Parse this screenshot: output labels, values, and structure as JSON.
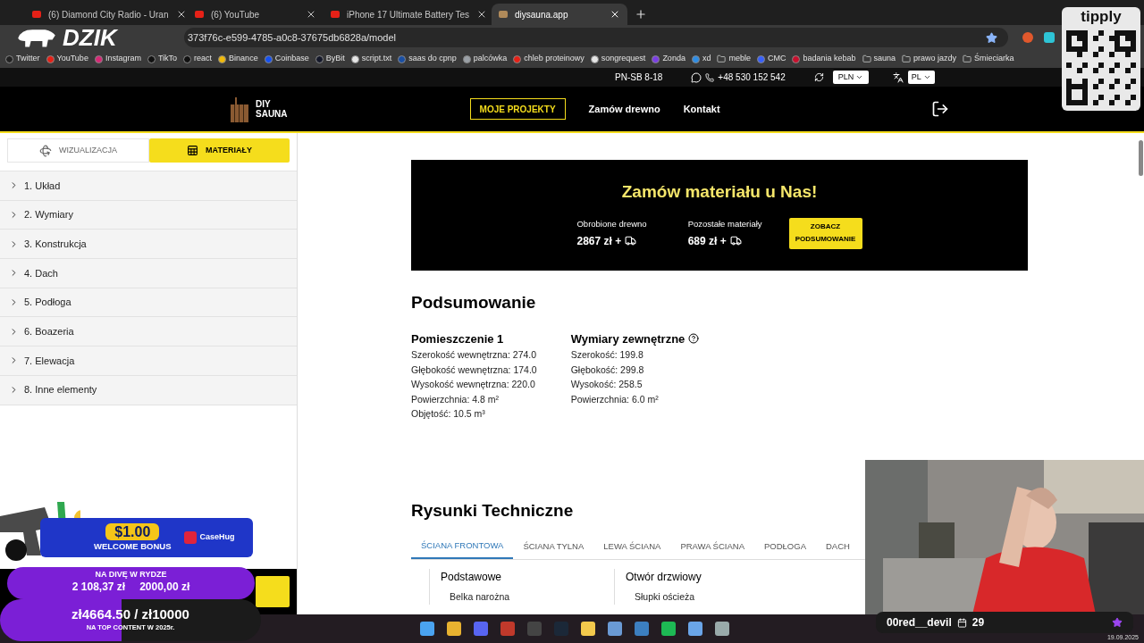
{
  "browser": {
    "tabs": [
      {
        "title": "(6) Diamond City Radio - Uran",
        "selected": false
      },
      {
        "title": "(6) YouTube",
        "selected": false
      },
      {
        "title": "iPhone 17 Ultimate Battery Tes",
        "selected": false
      },
      {
        "title": "diysauna.app",
        "selected": true
      }
    ],
    "url": "373f76c-e599-4785-a0c8-37675db6828a/model",
    "bookmarks": [
      {
        "label": "Twitter",
        "kind": "site",
        "color": "#222222"
      },
      {
        "label": "YouTube",
        "kind": "site",
        "color": "#e62117"
      },
      {
        "label": "Instagram",
        "kind": "site",
        "color": "#d62976"
      },
      {
        "label": "TikTo",
        "kind": "site",
        "color": "#111111"
      },
      {
        "label": "react",
        "kind": "site",
        "color": "#111111"
      },
      {
        "label": "Binance",
        "kind": "site",
        "color": "#f0b90b"
      },
      {
        "label": "Coinbase",
        "kind": "site",
        "color": "#1652f0"
      },
      {
        "label": "ByBit",
        "kind": "site",
        "color": "#15192a"
      },
      {
        "label": "script.txt",
        "kind": "site",
        "color": "#e6e6e6"
      },
      {
        "label": "saas do cpnp",
        "kind": "site",
        "color": "#1a4fa3"
      },
      {
        "label": "palcówka",
        "kind": "site",
        "color": "#9aa0a6"
      },
      {
        "label": "chleb proteinowy",
        "kind": "site",
        "color": "#e62117"
      },
      {
        "label": "songrequest",
        "kind": "site",
        "color": "#e6e6e6"
      },
      {
        "label": "Zonda",
        "kind": "site",
        "color": "#7b3fe4"
      },
      {
        "label": "xd",
        "kind": "site",
        "color": "#2f8de4"
      },
      {
        "label": "meble",
        "kind": "folder"
      },
      {
        "label": "CMC",
        "kind": "site",
        "color": "#3861fb"
      },
      {
        "label": "badania kebab",
        "kind": "site",
        "color": "#c8102e"
      },
      {
        "label": "sauna",
        "kind": "folder"
      },
      {
        "label": "prawo jazdy",
        "kind": "folder"
      },
      {
        "label": "Śmieciarka",
        "kind": "folder"
      }
    ]
  },
  "site": {
    "info_bar": {
      "hours": "PN-SB 8-18",
      "phone": "+48 530 152 542",
      "currency": "PLN",
      "language": "PL"
    },
    "logo": {
      "line1": "DIY",
      "line2": "SAUNA"
    },
    "nav": [
      {
        "label": "MOJE PROJEKTY",
        "kind": "button"
      },
      {
        "label": "Zamów drewno",
        "kind": "link"
      },
      {
        "label": "Kontakt",
        "kind": "link"
      }
    ],
    "view_toggle": [
      {
        "label": "WIZUALIZACJA",
        "selected": false
      },
      {
        "label": "MATERIAŁY",
        "selected": true
      }
    ],
    "sections": [
      {
        "label": "1. Układ",
        "expanded": false
      },
      {
        "label": "2. Wymiary",
        "expanded": false
      },
      {
        "label": "3. Konstrukcja",
        "expanded": false
      },
      {
        "label": "4. Dach",
        "expanded": false
      },
      {
        "label": "5. Podłoga",
        "expanded": false
      },
      {
        "label": "6. Boazeria",
        "expanded": false
      },
      {
        "label": "7. Elewacja",
        "expanded": false
      },
      {
        "label": "8. Inne elementy",
        "expanded": false
      }
    ],
    "banner": {
      "title": "Zamów materiału u Nas!",
      "prices": [
        {
          "label": "Obrobione drewno",
          "value": "2867 zł +"
        },
        {
          "label": "Pozostałe materiały",
          "value": "689 zł +"
        }
      ],
      "button_lines": [
        "ZOBACZ",
        "PODSUMOWANIE"
      ]
    },
    "summary": {
      "title": "Podsumowanie",
      "columns": [
        {
          "heading": "Pomieszczenie 1",
          "help": false,
          "lines": [
            "Szerokość wewnętrzna: 274.0",
            "Głębokość wewnętrzna: 174.0",
            "Wysokość wewnętrzna: 220.0",
            "Powierzchnia: 4.8 m²",
            "Objętość: 10.5 m³"
          ]
        },
        {
          "heading": "Wymiary zewnętrzne",
          "help": true,
          "lines": [
            "Szerokość: 199.8",
            "Głębokość: 299.8",
            "Wysokość: 258.5",
            "Powierzchnia: 6.0 m²"
          ]
        }
      ]
    },
    "drawings": {
      "title": "Rysunki Techniczne",
      "tabs": [
        {
          "label": "ŚCIANA FRONTOWA",
          "selected": true
        },
        {
          "label": "ŚCIANA TYLNA",
          "selected": false
        },
        {
          "label": "LEWA ŚCIANA",
          "selected": false
        },
        {
          "label": "PRAWA ŚCIANA",
          "selected": false
        },
        {
          "label": "PODŁOGA",
          "selected": false
        },
        {
          "label": "DACH",
          "selected": false
        }
      ],
      "groups": [
        {
          "heading": "Podstawowe",
          "items": [
            "Belka narożna"
          ]
        },
        {
          "heading": "Otwór drzwiowy",
          "items": [
            "Słupki ościeża"
          ]
        }
      ]
    }
  },
  "overlays": {
    "logo": "DZIK",
    "tipply": "tipply",
    "promo": {
      "amount": "$1.00",
      "caption": "WELCOME BONUS",
      "brand": "CaseHug"
    },
    "goal_1": {
      "title": "NA DIVĘ W RYDZE",
      "amounts": [
        "2 108,37 zł",
        "2000,00 zł"
      ]
    },
    "goal_2": {
      "progress": "zł4664.50 / zł10000",
      "caption": "NA TOP CONTENT W 2025r.",
      "level": 0.4664
    },
    "webcam": {
      "kind": "picture",
      "user": "00red__devil",
      "count": "29"
    },
    "taskbar": {
      "date": "19.09.2025"
    }
  }
}
